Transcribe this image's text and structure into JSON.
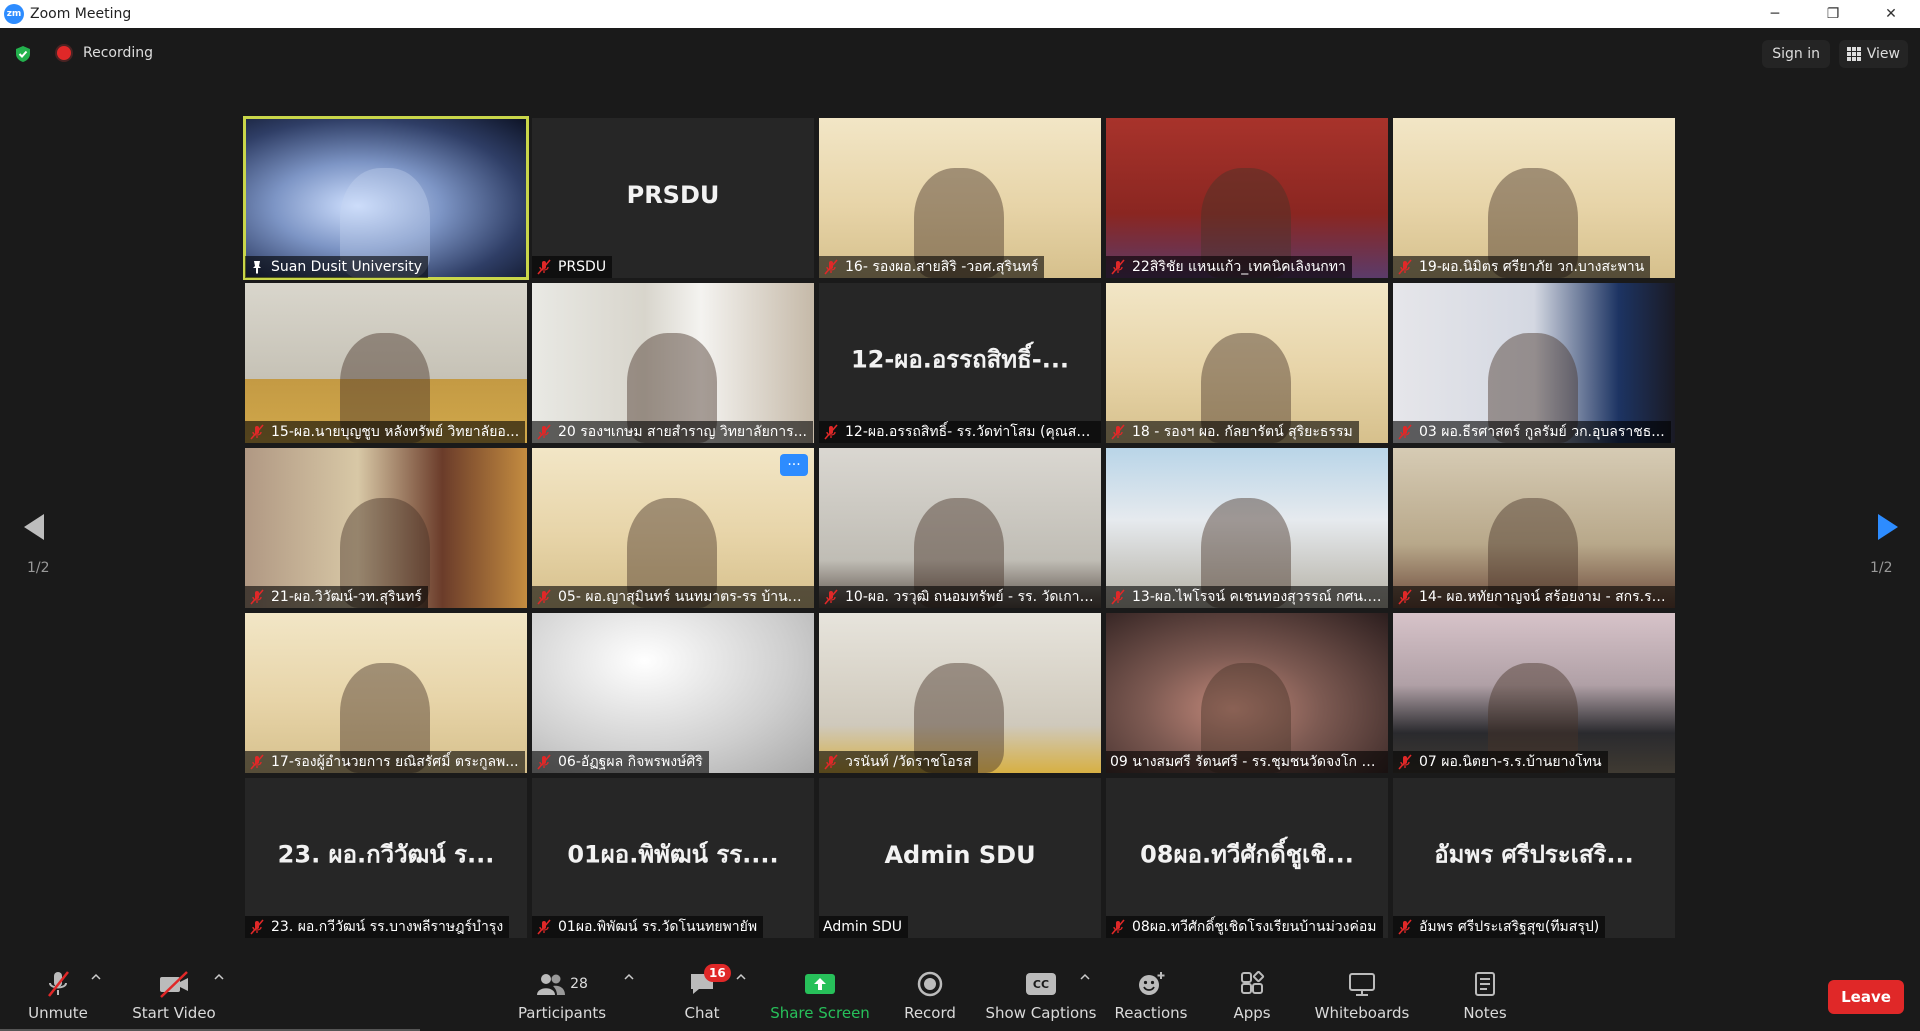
{
  "window": {
    "logo": "zm",
    "title": "Zoom Meeting",
    "controls": [
      "─",
      "❐",
      "✕"
    ]
  },
  "status": {
    "recording_label": "Recording",
    "sign_in": "Sign in",
    "view": "View"
  },
  "page_indicator": {
    "left": "1/2",
    "right": "1/2"
  },
  "tiles": [
    {
      "name": "Suan Dusit University",
      "big": "",
      "muted": false,
      "pinned": true,
      "active": true,
      "bg": "car"
    },
    {
      "name": "PRSDU",
      "big": "PRSDU",
      "muted": true,
      "bg": "none"
    },
    {
      "name": "16- รองผอ.สายสิริ -วอศ.สุรินทร์",
      "big": "",
      "muted": true,
      "bg": "slide"
    },
    {
      "name": "22สิริชัย แหนแก้ว_เทคนิคเลิงนกทา",
      "big": "",
      "muted": true,
      "bg": "door"
    },
    {
      "name": "19-ผอ.นิมิตร ศรียาภัย วก.บางสะพาน",
      "big": "",
      "muted": true,
      "bg": "slide"
    },
    {
      "name": "15-ผอ.นายบุญชูบ หลังทรัพย์ วิทยาลัยอ...",
      "big": "",
      "muted": true,
      "bg": "room1"
    },
    {
      "name": "20 รองฯเกษม สายสำราญ วิทยาลัยการ...",
      "big": "",
      "muted": true,
      "bg": "room2"
    },
    {
      "name": "12-ผอ.อรรถสิทธิ์- รร.วัดท่าโสม (คุณสา...",
      "big": "12-ผอ.อรรถสิทธิ์-...",
      "muted": true,
      "bg": "none"
    },
    {
      "name": "18 - รองฯ ผอ. กัลยารัตน์ สุริยะธรรม",
      "big": "",
      "muted": true,
      "bg": "slide"
    },
    {
      "name": "03 ผอ.ธีรศาสตร์ กูลรัมย์ วก.อุบลราชธ...",
      "big": "",
      "muted": true,
      "bg": "office"
    },
    {
      "name": "21-ผอ.วิวัฒน์-วท.สุรินทร์",
      "big": "",
      "muted": true,
      "bg": "living"
    },
    {
      "name": "05- ผอ.ญาสุมินทร์ นนทมาตร-รร บ้านด...",
      "big": "",
      "muted": true,
      "bg": "slide",
      "more": "···"
    },
    {
      "name": "10-ผอ. วรวุฒิ ถนอมทรัพย์ - รร. วัดเกาะ...",
      "big": "",
      "muted": true,
      "bg": "blur1"
    },
    {
      "name": "13-ผอ.ไพโรจน์ คเชนทองสุวรรณ์ กศน.อ...",
      "big": "",
      "muted": true,
      "bg": "temple"
    },
    {
      "name": "14- ผอ.หทัยกาญจน์ สร้อยงาม - สกร.ระ...",
      "big": "",
      "muted": true,
      "bg": "portrait"
    },
    {
      "name": "17-รองผู้อำนวยการ ยณิสรัศมิ์ ตระกูลพ...",
      "big": "",
      "muted": true,
      "bg": "slide"
    },
    {
      "name": "06-อัฏฐผล กิจพรพงษ์ศิริ",
      "big": "",
      "muted": true,
      "bg": "wall"
    },
    {
      "name": "วรนันท์ /วัดราชโอรส",
      "big": "",
      "muted": true,
      "bg": "ceiling"
    },
    {
      "name": "09 นางสมศรี รัตนศรี - รร.ชุมชนวัดจงโก มิต...",
      "big": "",
      "muted": false,
      "bg": "face"
    },
    {
      "name": "07 ผอ.นิตยา-ร.ร.บ้านยางโทน",
      "big": "",
      "muted": true,
      "bg": "desk"
    },
    {
      "name": "23. ผอ.กวีวัฒน์ รร.บางพลีราษฎร์บำรุง",
      "big": "23. ผอ.กวีวัฒน์ ร...",
      "muted": true,
      "bg": "none"
    },
    {
      "name": "01ผอ.พิพัฒน์ รร.วัดโนนทยพายัพ",
      "big": "01ผอ.พิพัฒน์ รร....",
      "muted": true,
      "bg": "none"
    },
    {
      "name": "Admin SDU",
      "big": "Admin SDU",
      "muted": false,
      "bg": "none"
    },
    {
      "name": "08ผอ.ทวีศักดิ์ชูเชิดโรงเรียนบ้านม่วงค่อม",
      "big": "08ผอ.ทวีศักดิ์ชูเชิ...",
      "muted": true,
      "bg": "none"
    },
    {
      "name": "อัมพร ศรีประเสริฐสุข(ทีมสรุป)",
      "big": "อัมพร ศรีประเสริ...",
      "muted": true,
      "bg": "none"
    }
  ],
  "toolbar": {
    "unmute": "Unmute",
    "start_video": "Start Video",
    "participants": "Participants",
    "participants_count": "28",
    "chat": "Chat",
    "chat_badge": "16",
    "share_screen": "Share Screen",
    "record": "Record",
    "show_captions": "Show Captions",
    "captions_icon": "CC",
    "reactions": "Reactions",
    "apps": "Apps",
    "whiteboards": "Whiteboards",
    "notes": "Notes",
    "leave": "Leave"
  },
  "colors": {
    "accent": "#2d8cff",
    "active_speaker": "#c9d64a",
    "muted_red": "#e02828",
    "share_green": "#27c05a",
    "background": "#1a1a1a"
  }
}
